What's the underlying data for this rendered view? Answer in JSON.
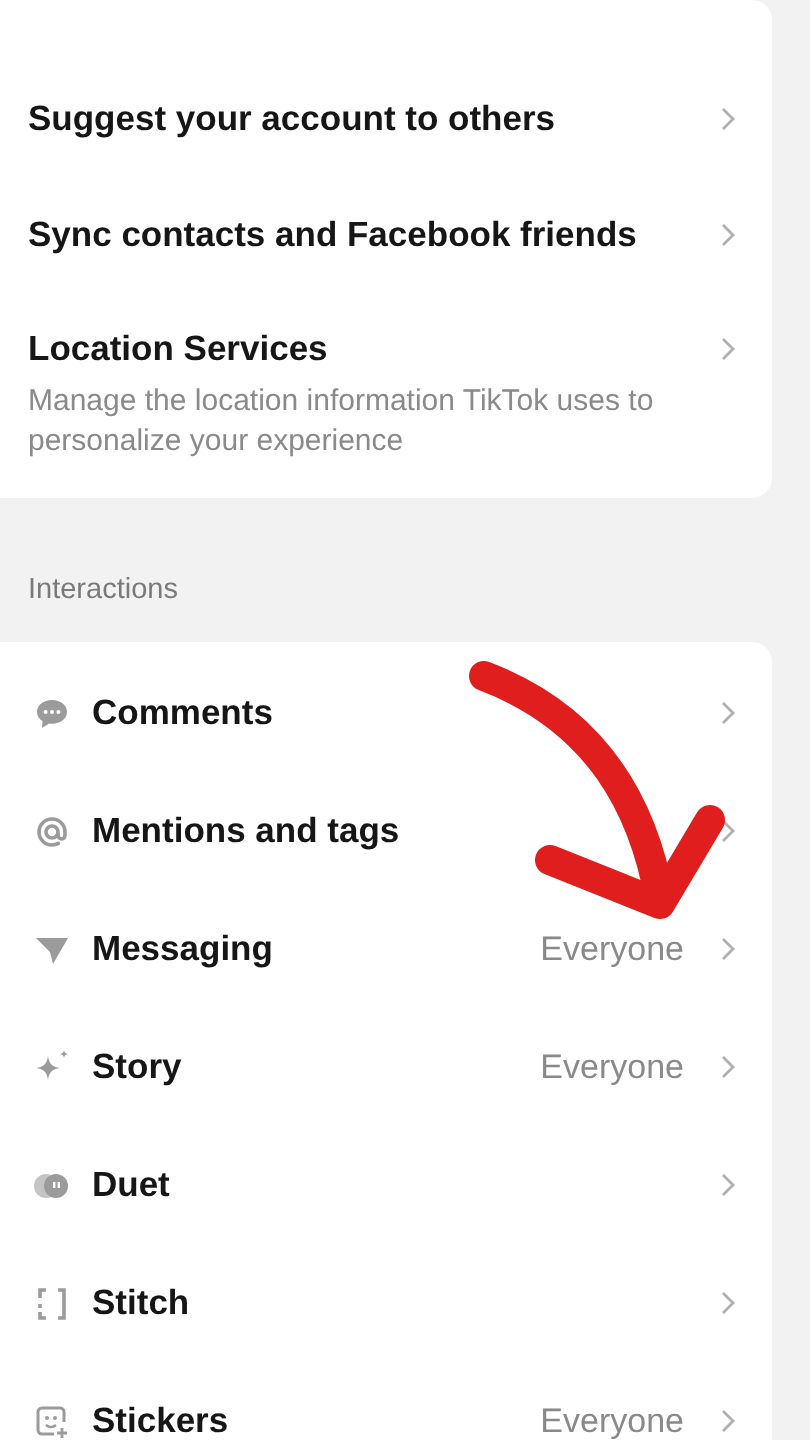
{
  "privacy_card": {
    "rows": [
      {
        "title": "Suggest your account to others"
      },
      {
        "title": "Sync contacts and Facebook friends"
      },
      {
        "title": "Location Services",
        "description": "Manage the location information TikTok uses to personalize your experience"
      }
    ]
  },
  "interactions": {
    "header": "Interactions",
    "rows": [
      {
        "title": "Comments"
      },
      {
        "title": "Mentions and tags"
      },
      {
        "title": "Messaging",
        "value": "Everyone"
      },
      {
        "title": "Story",
        "value": "Everyone"
      },
      {
        "title": "Duet"
      },
      {
        "title": "Stitch"
      },
      {
        "title": "Stickers",
        "value": "Everyone"
      }
    ]
  },
  "annotation": {
    "kind": "arrow"
  }
}
